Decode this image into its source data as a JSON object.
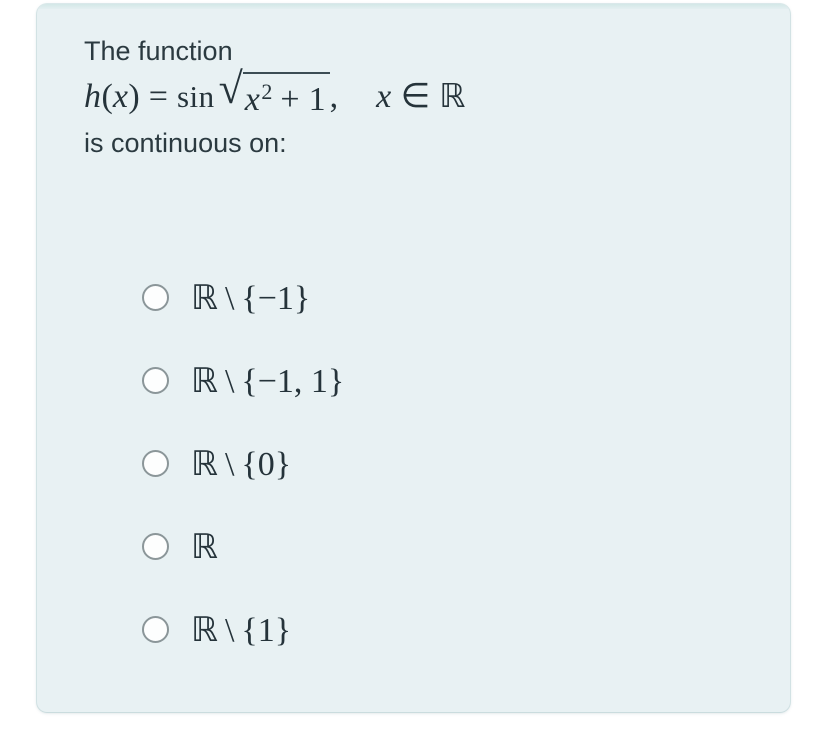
{
  "card": {
    "background_color": "#e8f1f3",
    "accent_color": "#d3e7e7"
  },
  "question": {
    "line1": "The function",
    "line3": "is continuous on:",
    "formula": {
      "plain_text": "h(x) = sin √(x² + 1),   x ∈ ℝ",
      "function_name": "h",
      "variable": "x",
      "equals": "=",
      "operator": "sin",
      "radicand_base": "x",
      "radicand_exponent": "2",
      "radicand_plus": "+",
      "radicand_addend": "1",
      "comma": ",",
      "domain_variable": "x",
      "element_of": "∈",
      "domain_set": "ℝ",
      "open_paren": "(",
      "close_paren": ")"
    }
  },
  "options": [
    {
      "id": "option-1",
      "selected": false,
      "plain_text": "ℝ \\ {−1}",
      "set_symbol": "ℝ",
      "setminus": "\\",
      "brace_open": "{",
      "elements": "−1",
      "brace_close": "}"
    },
    {
      "id": "option-2",
      "selected": false,
      "plain_text": "ℝ \\ {−1, 1}",
      "set_symbol": "ℝ",
      "setminus": "\\",
      "brace_open": "{",
      "elements": "−1, 1",
      "brace_close": "}"
    },
    {
      "id": "option-3",
      "selected": false,
      "plain_text": "ℝ \\ {0}",
      "set_symbol": "ℝ",
      "setminus": "\\",
      "brace_open": "{",
      "elements": "0",
      "brace_close": "}"
    },
    {
      "id": "option-4",
      "selected": false,
      "plain_text": "ℝ",
      "set_symbol": "ℝ",
      "setminus": "",
      "brace_open": "",
      "elements": "",
      "brace_close": ""
    },
    {
      "id": "option-5",
      "selected": false,
      "plain_text": "ℝ \\ {1}",
      "set_symbol": "ℝ",
      "setminus": "\\",
      "brace_open": "{",
      "elements": "1",
      "brace_close": "}"
    }
  ]
}
